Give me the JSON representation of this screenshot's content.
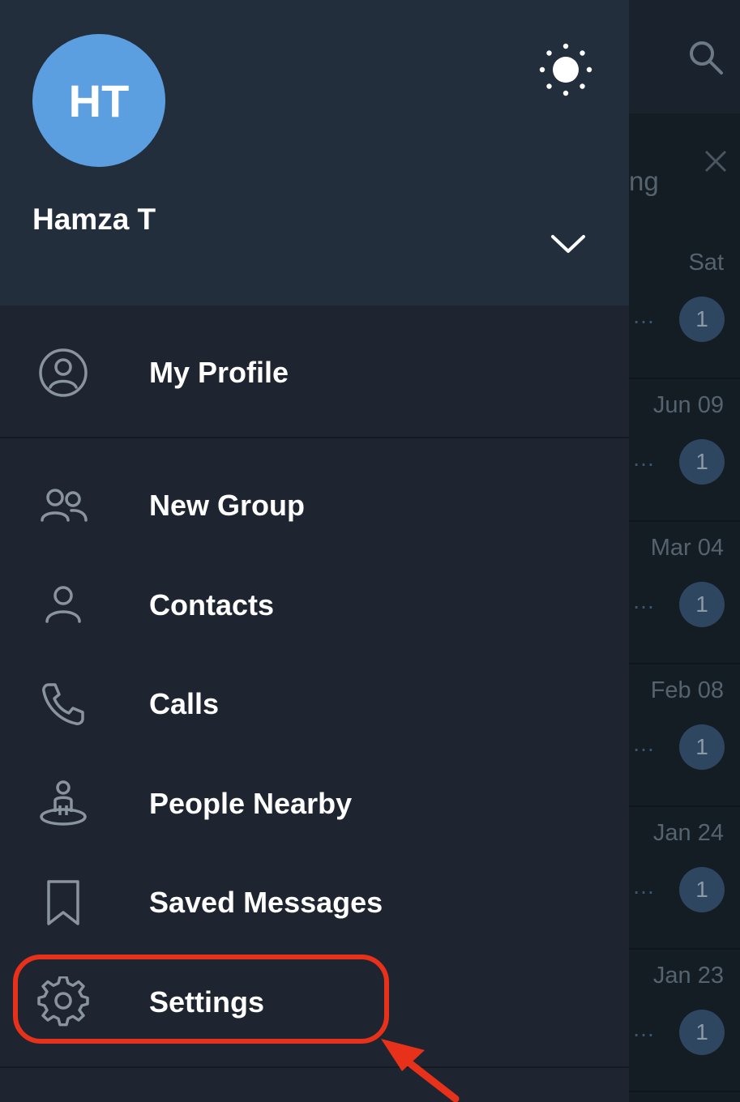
{
  "profile": {
    "initials": "HT",
    "name": "Hamza T"
  },
  "menu": [
    {
      "label": "My Profile",
      "icon": "user-circle-icon"
    },
    {
      "label": "New Group",
      "icon": "group-icon"
    },
    {
      "label": "Contacts",
      "icon": "person-icon"
    },
    {
      "label": "Calls",
      "icon": "phone-icon"
    },
    {
      "label": "People Nearby",
      "icon": "people-nearby-icon"
    },
    {
      "label": "Saved Messages",
      "icon": "bookmark-icon"
    },
    {
      "label": "Settings",
      "icon": "gear-icon"
    }
  ],
  "background_chats": {
    "partial_text": "ng",
    "rows": [
      {
        "date": "Sat",
        "unread": "1"
      },
      {
        "date": "Jun 09",
        "unread": "1"
      },
      {
        "date": "Mar 04",
        "unread": "1"
      },
      {
        "date": "Feb 08",
        "unread": "1"
      },
      {
        "date": "Jan 24",
        "unread": "1"
      },
      {
        "date": "Jan 23",
        "unread": "1"
      }
    ]
  },
  "colors": {
    "avatar": "#5c9fe0",
    "drawer_header": "#232e3d",
    "drawer_body": "#1e2530",
    "highlight": "#e8311a"
  }
}
